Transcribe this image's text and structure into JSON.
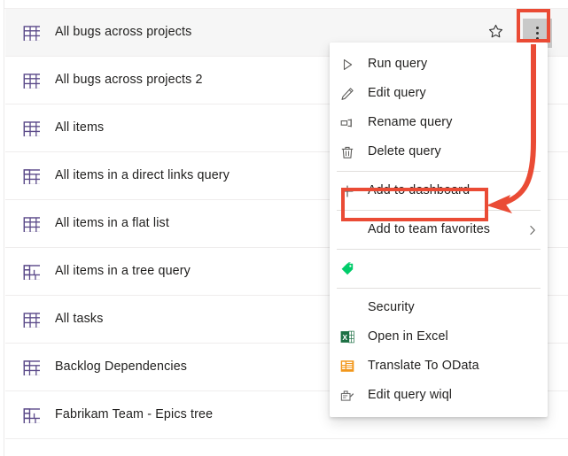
{
  "window": {
    "title": "Azure DevOps query list with context menu"
  },
  "query_list": {
    "rows": [
      {
        "label": "All bugs across projects",
        "icon": "flat-list-query-icon",
        "hovered": true,
        "show_actions": true
      },
      {
        "label": "All bugs across projects 2",
        "icon": "flat-list-query-icon",
        "hovered": false,
        "show_actions": false
      },
      {
        "label": "All items",
        "icon": "flat-list-query-icon",
        "hovered": false,
        "show_actions": false
      },
      {
        "label": "All items in a direct links query",
        "icon": "direct-links-query-icon",
        "hovered": false,
        "show_actions": false
      },
      {
        "label": "All items in a flat list",
        "icon": "flat-list-query-icon",
        "hovered": false,
        "show_actions": false
      },
      {
        "label": "All items in a tree query",
        "icon": "tree-query-icon",
        "hovered": false,
        "show_actions": false
      },
      {
        "label": "All tasks",
        "icon": "flat-list-query-icon",
        "hovered": false,
        "show_actions": false
      },
      {
        "label": "Backlog Dependencies",
        "icon": "direct-links-query-icon",
        "hovered": false,
        "show_actions": false
      },
      {
        "label": "Fabrikam Team - Epics tree",
        "icon": "tree-query-icon",
        "hovered": false,
        "show_actions": false
      }
    ],
    "row_actions": {
      "favorite_icon": "star-outline-icon",
      "more_icon": "more-vertical-icon"
    }
  },
  "context_menu": {
    "items": [
      {
        "label": "Run query",
        "icon": "play-icon",
        "type": "item"
      },
      {
        "label": "Edit query",
        "icon": "pencil-icon",
        "type": "item"
      },
      {
        "label": "Rename query",
        "icon": "rename-icon",
        "type": "item"
      },
      {
        "label": "Delete query",
        "icon": "trash-icon",
        "type": "item"
      },
      {
        "label": "",
        "icon": "",
        "type": "separator"
      },
      {
        "label": "Add to dashboard",
        "icon": "plus-icon",
        "type": "item",
        "highlighted": true
      },
      {
        "label": "",
        "icon": "",
        "type": "separator"
      },
      {
        "label": "Add to team favorites",
        "icon": "",
        "type": "submenu"
      },
      {
        "label": "",
        "icon": "",
        "type": "separator"
      },
      {
        "label": "",
        "icon": "tag-icon",
        "type": "item"
      },
      {
        "label": "",
        "icon": "",
        "type": "separator"
      },
      {
        "label": "Security",
        "icon": "",
        "type": "item"
      },
      {
        "label": "Open in Excel",
        "icon": "excel-icon",
        "type": "item"
      },
      {
        "label": "Translate To OData",
        "icon": "odata-icon",
        "type": "item"
      },
      {
        "label": "Edit query wiql",
        "icon": "edit-wiql-icon",
        "type": "item"
      }
    ]
  },
  "annotations": {
    "highlight_color": "#ea4b35",
    "more_button_box": "more-actions-button",
    "add_to_dashboard_box": "add-to-dashboard-item",
    "arrow": "curved-arrow-from-more-button-to-add-to-dashboard"
  },
  "colors": {
    "row_hover_bg": "#f6f6f6",
    "separator": "#efeded",
    "text": "#201f1e",
    "menu_separator": "#e1dfdd",
    "annotation_red": "#ea4b35",
    "more_button_bg": "#c9c9c9",
    "excel_green": "#1d7044",
    "odata_orange": "#f2971c",
    "tag_green": "#00cc6a"
  }
}
